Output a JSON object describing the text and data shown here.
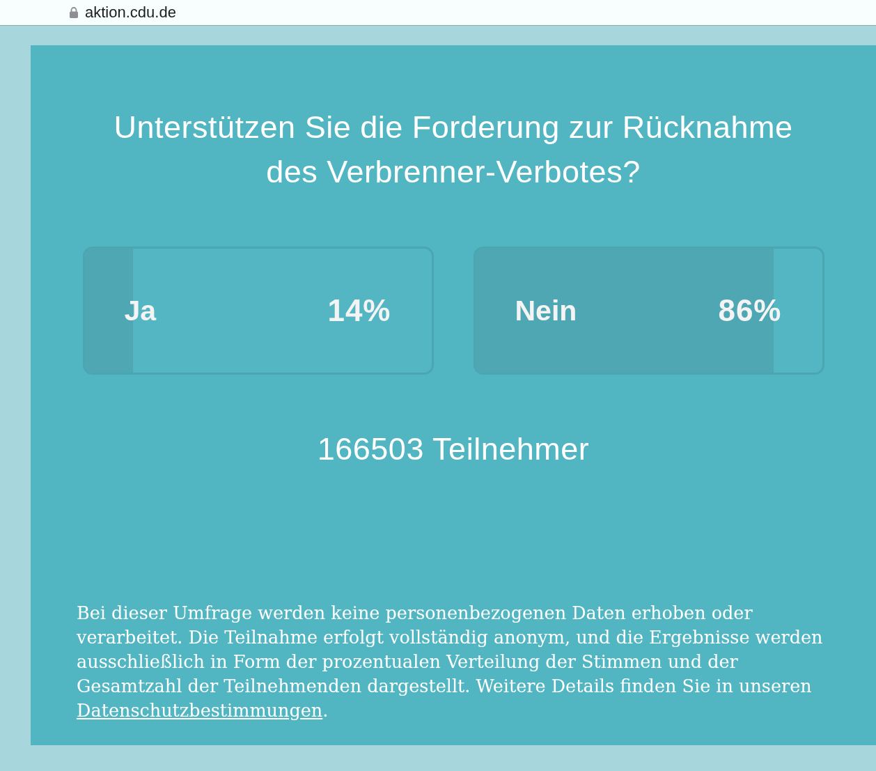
{
  "browser": {
    "url": "aktion.cdu.de"
  },
  "poll": {
    "question": "Unterstützen Sie die Forderung zur Rücknahme des Verbrenner-Verbotes?",
    "options": [
      {
        "label": "Ja",
        "percent": "14%",
        "level": 0.14
      },
      {
        "label": "Nein",
        "percent": "86%",
        "level": 0.86
      }
    ],
    "participants": "166503 Teilnehmer"
  },
  "privacy_note": {
    "text": "Bei dieser Umfrage werden keine personenbezogenen Daten erhoben oder verarbeitet. Die Teilnahme erfolgt vollständig anonym, und die Ergebnisse werden ausschließlich in Form der prozentualen Verteilung der Stimmen und der Gesamtzahl der Teilnehmenden dargestellt. Weitere Details finden Sie in unseren",
    "link": "Datenschutzbestimmungen",
    "after_link": "."
  }
}
